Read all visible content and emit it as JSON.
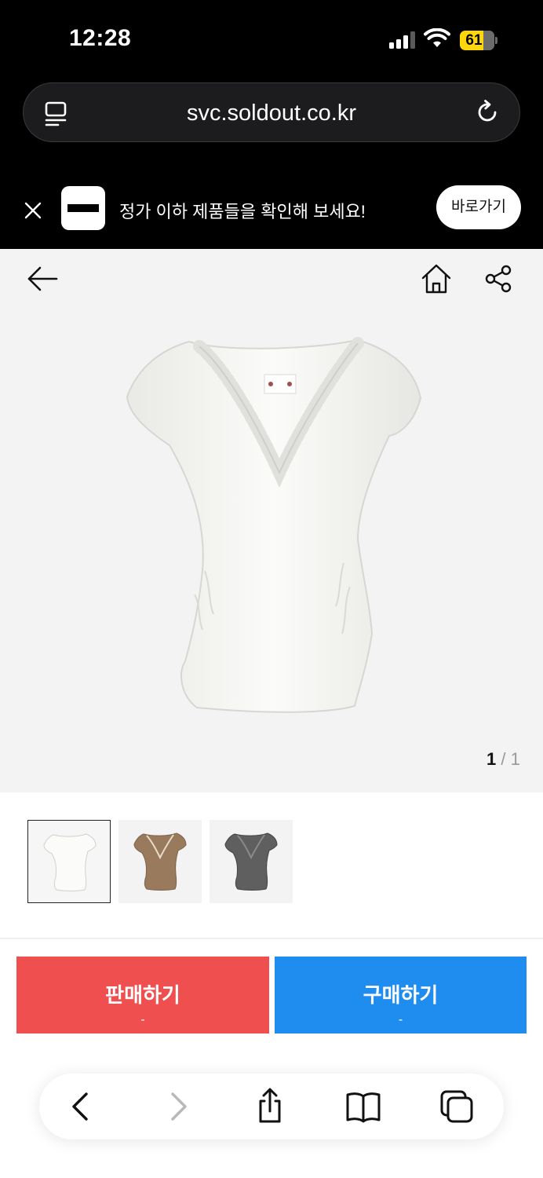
{
  "status_bar": {
    "time": "12:28",
    "battery_level": "61",
    "battery_color": "#ffd60a"
  },
  "browser": {
    "url": "svc.soldout.co.kr",
    "icons": [
      "reader-mode-icon",
      "reload-icon"
    ]
  },
  "banner": {
    "message": "정가 이하 제품들을 확인해 보세요!",
    "button_label": "바로가기",
    "icons": [
      "close-icon",
      "app-logo-icon"
    ]
  },
  "product": {
    "header_icons": [
      "back-arrow-icon",
      "home-icon",
      "share-icon"
    ],
    "pager": {
      "current": "1",
      "separator": " / ",
      "total": "1"
    },
    "thumbnails": [
      {
        "name": "white",
        "color": "#f4f4f2",
        "selected": true
      },
      {
        "name": "brown",
        "color": "#9a7a5c",
        "selected": false
      },
      {
        "name": "grey",
        "color": "#5f5f5f",
        "selected": false
      }
    ]
  },
  "actions": {
    "sell": {
      "label": "판매하기",
      "price": "-",
      "color": "#ef4f4f"
    },
    "buy": {
      "label": "구매하기",
      "price": "-",
      "color": "#1f8cf0"
    }
  },
  "toolbar": {
    "icons": [
      "back-icon",
      "forward-icon",
      "share-icon",
      "bookmarks-icon",
      "tabs-icon"
    ]
  }
}
